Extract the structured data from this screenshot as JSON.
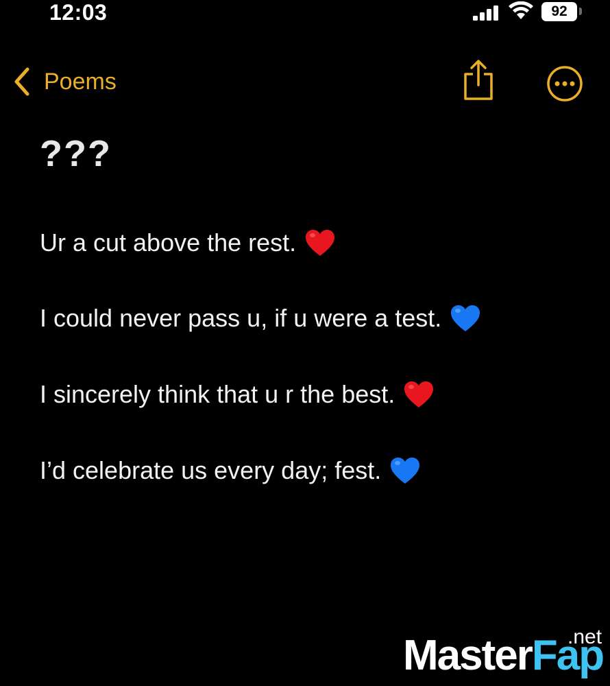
{
  "status_bar": {
    "time": "12:03",
    "battery_level": "92",
    "icons": [
      "signal-icon",
      "wifi-icon",
      "battery-icon"
    ]
  },
  "nav": {
    "back_label": "Poems",
    "back_icon": "chevron-left-icon",
    "share_icon": "share-icon",
    "more_icon": "more-icon",
    "accent_color": "#e9ae2a"
  },
  "note": {
    "title": "???",
    "lines": [
      {
        "text": "Ur a cut above the rest.",
        "emoji": "red-heart",
        "emoji_color": "#e8161e"
      },
      {
        "text": "I could never pass u, if u were a test.",
        "emoji": "blue-heart",
        "emoji_color": "#1877f2"
      },
      {
        "text": "I sincerely think that u r the best.",
        "emoji": "red-heart",
        "emoji_color": "#e8161e"
      },
      {
        "text": "I’d celebrate us every day; fest.",
        "emoji": "blue-heart",
        "emoji_color": "#1877f2"
      }
    ]
  },
  "watermark": {
    "master": "Master",
    "fap": "Fap",
    "net": ".net",
    "fap_color": "#3ec2f2"
  }
}
